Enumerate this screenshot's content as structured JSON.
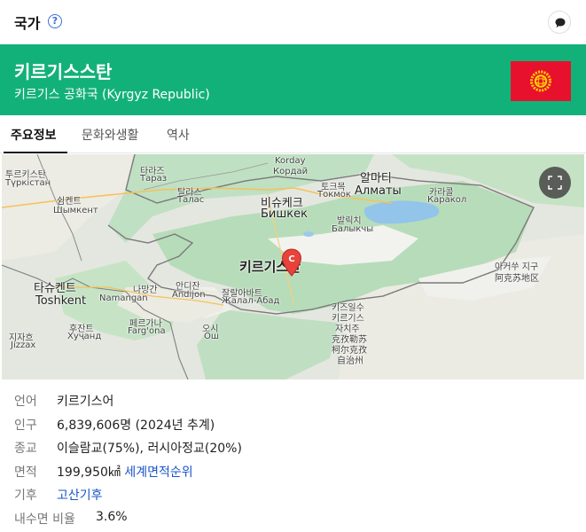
{
  "header": {
    "title": "국가",
    "help_glyph": "?"
  },
  "banner": {
    "name": "키르기스스탄",
    "subtitle": "키르기스 공화국 (Kyrgyz Republic)",
    "color": "#13b17a",
    "flag_colors": {
      "field": "#e8112d",
      "sun": "#ffd200"
    }
  },
  "tabs": [
    {
      "label": "주요정보",
      "active": true
    },
    {
      "label": "문화와생활",
      "active": false
    },
    {
      "label": "역사",
      "active": false
    }
  ],
  "map": {
    "pin_letter": "C",
    "labels": {
      "turkestan": "투르키스탄",
      "turkestan_cyr": "Түркістан",
      "taraz": "타라즈",
      "taraz_cyr": "Тараз",
      "korday": "Korday",
      "korday_cyr": "Кордай",
      "almaty": "알마티",
      "almaty_cyr": "Алматы",
      "tokmok": "토크목",
      "tokmok_cyr": "Токмок",
      "karakol": "카라콜",
      "karakol_cyr": "Каракол",
      "shymkent": "쉼켄트",
      "shymkent_cyr": "Шымкент",
      "talas": "탈라스",
      "talas_cyr": "Талас",
      "bishkek": "비슈케크",
      "bishkek_cyr": "Бишкек",
      "balykchy": "발릭치",
      "balykchy_cyr": "Балыкчы",
      "country": "키르기스탄",
      "tashkent": "타슈켄트",
      "tashkent_lat": "Toshkent",
      "namangan_ko": "나망간",
      "namangan": "Namangan",
      "andijan_ko": "안디잔",
      "andijan": "Andijon",
      "jalalabad": "잘랄아바트",
      "jalalabad_cyr": "Жалал-Абад",
      "khujand": "후잔트",
      "khujand_cyr": "Хуҷанд",
      "fergana": "페르가나",
      "fergana_lat": "Farg'ona",
      "osh": "오시",
      "osh_cyr": "Ош",
      "jizzakh": "지자흐",
      "jizzakh_lat": "Jizzax",
      "kizilsu_1": "키즈일수",
      "kizilsu_2": "키르기스",
      "kizilsu_3": "자치주",
      "kizilsu_zh1": "克孜勒苏",
      "kizilsu_zh2": "柯尔克孜",
      "kizilsu_zh3": "自治州",
      "aksu": "아커쑤 지구",
      "aksu_zh": "阿克苏地区"
    }
  },
  "info": [
    {
      "key": "언어",
      "value": "키르기스어"
    },
    {
      "key": "인구",
      "value": "6,839,606명 (2024년 추계)"
    },
    {
      "key": "종교",
      "value": "이슬람교(75%), 러시아정교(20%)"
    },
    {
      "key": "면적",
      "value": "199,950㎢",
      "link": "세계면적순위"
    },
    {
      "key": "기후",
      "link": "고산기후"
    },
    {
      "key": "내수면 비율",
      "value": "3.6%"
    }
  ]
}
